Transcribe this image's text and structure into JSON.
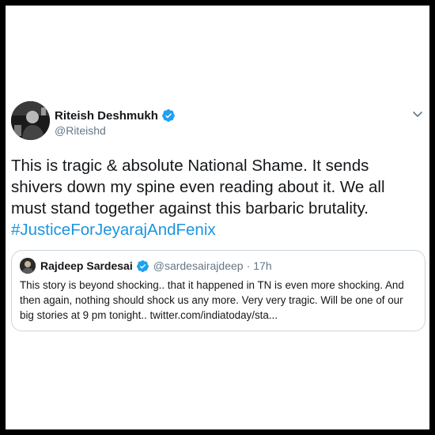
{
  "tweet": {
    "author": {
      "display_name": "Riteish Deshmukh",
      "handle": "@Riteishd",
      "verified": true
    },
    "text": "This is tragic & absolute National Shame. It sends shivers down my spine even reading about it. We all must stand together against this barbaric brutality.",
    "hashtag": "#JusticeForJeyarajAndFenix",
    "icons": {
      "verified": "verified-badge-icon",
      "menu": "chevron-down-icon"
    }
  },
  "quoted_tweet": {
    "author": {
      "display_name": "Rajdeep Sardesai",
      "handle": "@sardesairajdeep",
      "verified": true
    },
    "separator": "·",
    "time": "17h",
    "text": "This story is beyond shocking.. that it happened in TN is even more shocking. And then again, nothing should shock us any more. Very very tragic. Will be one of our big stories at 9 pm tonight.. twitter.com/indiatoday/sta..."
  },
  "colors": {
    "frame": "#000000",
    "text": "#14171a",
    "secondary": "#657786",
    "accent": "#1b95e0",
    "verified": "#1da1f2",
    "border": "#ccd6dd"
  }
}
